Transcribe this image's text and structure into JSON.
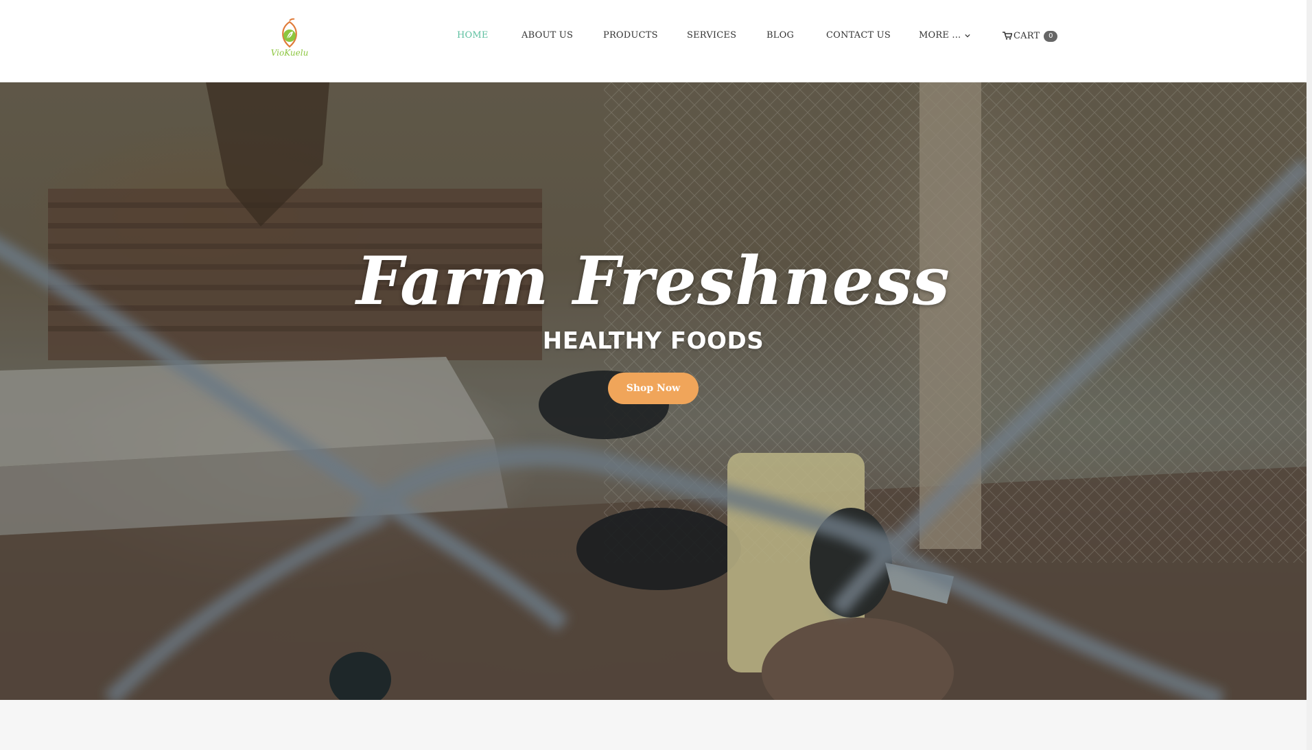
{
  "brand": {
    "logo_text": "VioKuelu",
    "colors": {
      "accent": "#5cbf9f",
      "button": "#f0a55a",
      "logo_green": "#8cc63f",
      "logo_orange": "#e07b39"
    }
  },
  "nav": {
    "items": [
      {
        "label": "HOME",
        "active": true
      },
      {
        "label": "ABOUT US",
        "active": false
      },
      {
        "label": "PRODUCTS",
        "active": false
      },
      {
        "label": "SERVICES",
        "active": false
      },
      {
        "label": "BLOG",
        "active": false
      },
      {
        "label": "CONTACT US",
        "active": false
      }
    ],
    "more_label": "MORE ...",
    "more_icon": "chevron-down-icon",
    "cart_label": "CART",
    "cart_icon": "shopping-cart-icon",
    "cart_count": "0"
  },
  "hero": {
    "title": "Farm Freshness",
    "subtitle": "HEALTHY FOODS",
    "cta_label": "Shop Now"
  }
}
